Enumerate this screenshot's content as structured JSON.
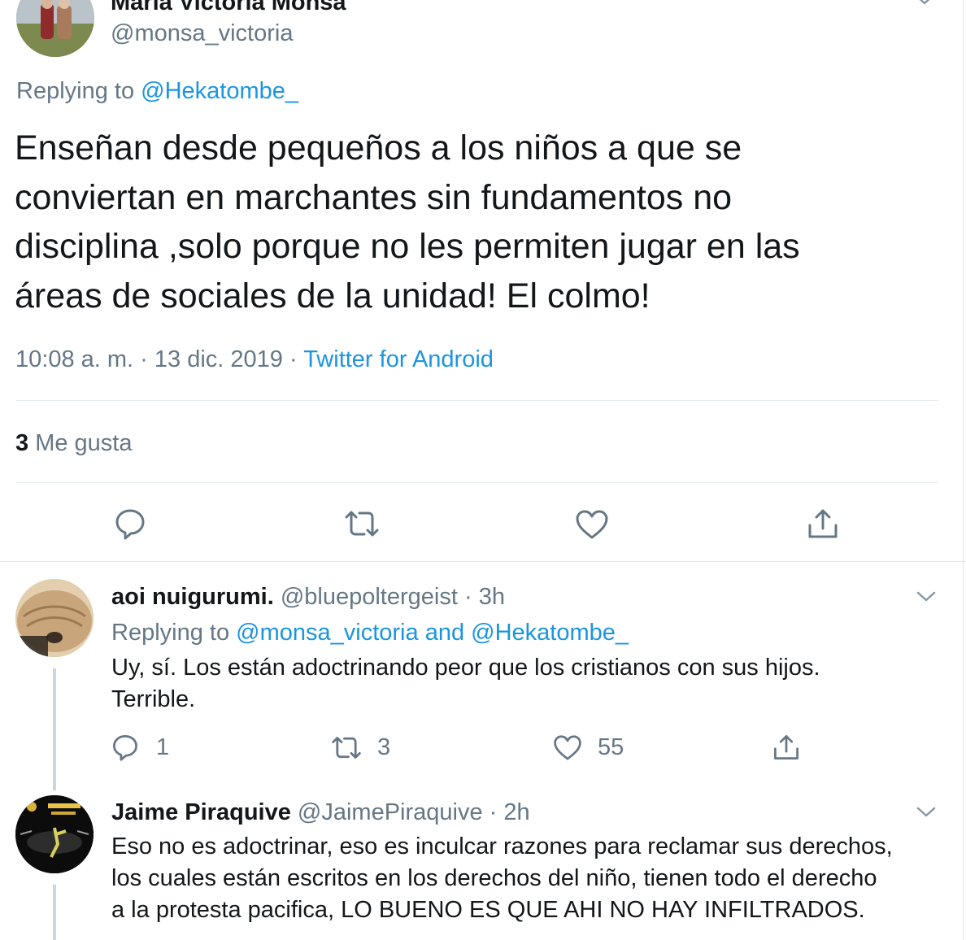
{
  "main_tweet": {
    "display_name": "María Victoria Monsa",
    "handle": "@monsa_victoria",
    "replying_prefix": "Replying to",
    "replying_to": "@Hekatombe_",
    "text_lines": [
      "Enseñan desde pequeños a los niños a que se",
      "conviertan en marchantes sin fundamentos no",
      "disciplina ,solo porque no les permiten jugar en las",
      "áreas de sociales de la unidad! El colmo!"
    ],
    "time": "10:08 a. m.",
    "date": "13 dic. 2019",
    "separator": "·",
    "source": "Twitter for Android",
    "likes_count": "3",
    "likes_label": "Me gusta",
    "icons": [
      "reply-icon",
      "retweet-icon",
      "like-icon",
      "share-icon"
    ]
  },
  "replies": [
    {
      "display_name": "aoi nuigurumi.",
      "handle": "@bluepoltergeist",
      "separator": "·",
      "time": "3h",
      "replying_prefix": "Replying to",
      "replying_to_1": "@monsa_victoria",
      "replying_and": "and",
      "replying_to_2": "@Hekatombe_",
      "text_lines": [
        "Uy, sí. Los están adoctrinando peor que los cristianos con sus hijos.",
        "Terrible."
      ],
      "reply_count": "1",
      "retweet_count": "3",
      "like_count": "55"
    },
    {
      "display_name": "Jaime Piraquive",
      "handle": "@JaimePiraquive",
      "separator": "·",
      "time": "2h",
      "text_lines": [
        "Eso no es adoctrinar, eso es inculcar razones para reclamar sus derechos,",
        "los cuales están escritos en los derechos del niño, tienen todo el derecho",
        "a la protesta pacifica, LO BUENO ES QUE AHI NO HAY INFILTRADOS."
      ]
    }
  ],
  "colors": {
    "text": "#14171a",
    "secondary": "#657786",
    "link": "#1b95e0",
    "divider": "#e6ecf0"
  }
}
